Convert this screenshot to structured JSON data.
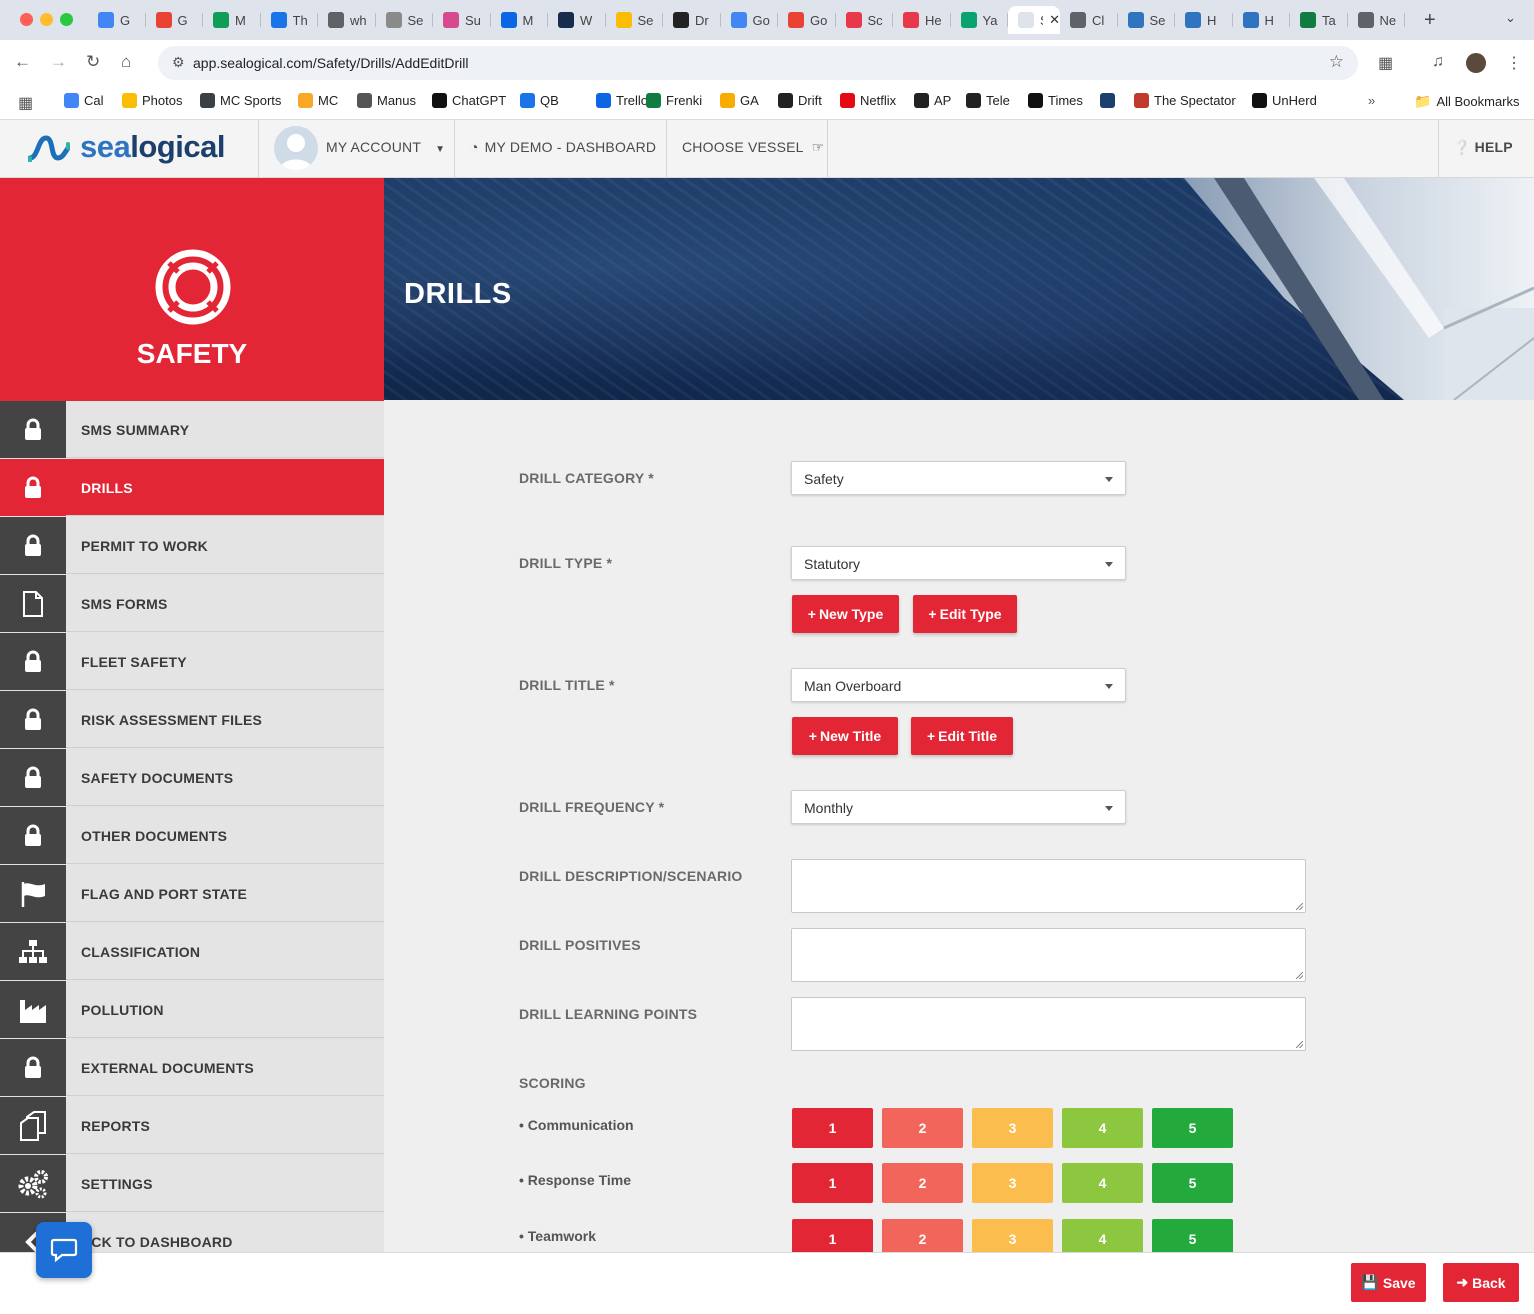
{
  "browser": {
    "tabs": [
      {
        "title": "G",
        "color": "#4285f4"
      },
      {
        "title": "G",
        "color": "#ea4335"
      },
      {
        "title": "M",
        "color": "#0f9d58"
      },
      {
        "title": "Th",
        "color": "#1a73e8"
      },
      {
        "title": "wh",
        "color": "#5f6368"
      },
      {
        "title": "Se",
        "color": "#8a8a8a"
      },
      {
        "title": "Su",
        "color": "#d64b8f"
      },
      {
        "title": "M",
        "color": "#0c66e4"
      },
      {
        "title": "W",
        "color": "#172b4d"
      },
      {
        "title": "Se",
        "color": "#fbbc04"
      },
      {
        "title": "Dr",
        "color": "#222222"
      },
      {
        "title": "Go",
        "color": "#4285f4"
      },
      {
        "title": "Go",
        "color": "#ea4335"
      },
      {
        "title": "Sc",
        "color": "#e8394a"
      },
      {
        "title": "He",
        "color": "#e8394a"
      },
      {
        "title": "Ya",
        "color": "#0aa36f"
      },
      {
        "title": "Se",
        "color": "#ffffff",
        "active": true
      },
      {
        "title": "Cl",
        "color": "#5f6368"
      },
      {
        "title": "Se",
        "color": "#2f74c0"
      },
      {
        "title": "H",
        "color": "#2f74c0"
      },
      {
        "title": "H",
        "color": "#2f74c0"
      },
      {
        "title": "Ta",
        "color": "#107c41"
      },
      {
        "title": "Ne",
        "color": "#5f6368"
      }
    ],
    "url": "app.sealogical.com/Safety/Drills/AddEditDrill",
    "bookmarks": [
      {
        "label": "Cal",
        "color": "#4285f4"
      },
      {
        "label": "Photos",
        "color": "#fbbc04"
      },
      {
        "label": "MC Sports",
        "color": "#3c4043"
      },
      {
        "label": "MC",
        "color": "#f9a825"
      },
      {
        "label": "Manus",
        "color": "#555555"
      },
      {
        "label": "ChatGPT",
        "color": "#111111"
      },
      {
        "label": "QB",
        "color": "#1a73e8"
      },
      {
        "label": "Trello",
        "color": "#0c66e4"
      },
      {
        "label": "Frenki",
        "color": "#107c41"
      },
      {
        "label": "GA",
        "color": "#f9ab00"
      },
      {
        "label": "Drift",
        "color": "#222222"
      },
      {
        "label": "Netflix",
        "color": "#e50914"
      },
      {
        "label": "AP",
        "color": "#222222"
      },
      {
        "label": "Tele",
        "color": "#222222"
      },
      {
        "label": "Times",
        "color": "#111111"
      },
      {
        "label": "",
        "color": "#1c3f6e"
      },
      {
        "label": "The Spectator",
        "color": "#c0392b"
      },
      {
        "label": "UnHerd",
        "color": "#111111"
      }
    ],
    "all_bookmarks": "All Bookmarks"
  },
  "header": {
    "logo_a": "sea",
    "logo_b": "logical",
    "my_account": "MY ACCOUNT",
    "dashboard": "MY DEMO - DASHBOARD",
    "choose_vessel": "CHOOSE VESSEL",
    "help": "HELP"
  },
  "sidebar": {
    "hero_title": "SAFETY",
    "items": [
      {
        "label": "SMS SUMMARY",
        "icon": "lock-icon"
      },
      {
        "label": "DRILLS",
        "icon": "lock-icon",
        "active": true
      },
      {
        "label": "PERMIT TO WORK",
        "icon": "lock-icon"
      },
      {
        "label": "SMS FORMS",
        "icon": "document-icon"
      },
      {
        "label": "FLEET SAFETY",
        "icon": "lock-icon"
      },
      {
        "label": "RISK ASSESSMENT FILES",
        "icon": "lock-icon"
      },
      {
        "label": "SAFETY DOCUMENTS",
        "icon": "lock-icon"
      },
      {
        "label": "OTHER DOCUMENTS",
        "icon": "lock-icon"
      },
      {
        "label": "FLAG AND PORT STATE",
        "icon": "flag-icon"
      },
      {
        "label": "CLASSIFICATION",
        "icon": "hierarchy-icon"
      },
      {
        "label": "POLLUTION",
        "icon": "factory-icon"
      },
      {
        "label": "EXTERNAL DOCUMENTS",
        "icon": "lock-icon"
      },
      {
        "label": "REPORTS",
        "icon": "copy-icon"
      },
      {
        "label": "SETTINGS",
        "icon": "gears-icon"
      },
      {
        "label": "ACK TO DASHBOARD",
        "icon": "chevron-left-icon"
      }
    ]
  },
  "banner": {
    "title": "DRILLS"
  },
  "form": {
    "category_label": "DRILL CATEGORY *",
    "category_value": "Safety",
    "type_label": "DRILL TYPE *",
    "type_value": "Statutory",
    "new_type": "New Type",
    "edit_type": "Edit Type",
    "title_label": "DRILL TITLE *",
    "title_value": "Man Overboard",
    "new_title": "New Title",
    "edit_title": "Edit Title",
    "frequency_label": "DRILL FREQUENCY *",
    "frequency_value": "Monthly",
    "description_label": "DRILL DESCRIPTION/SCENARIO",
    "positives_label": "DRILL POSITIVES",
    "learning_label": "DRILL LEARNING POINTS",
    "scoring_label": "SCORING",
    "scoring_rows": [
      "• Communication",
      "• Response Time",
      "• Teamwork"
    ],
    "scores": [
      "1",
      "2",
      "3",
      "4",
      "5"
    ],
    "score_colors": [
      "#e32636",
      "#f2655a",
      "#fbbd4d",
      "#8dc63f",
      "#23a93c"
    ]
  },
  "footer": {
    "save": "Save",
    "back": "Back"
  }
}
